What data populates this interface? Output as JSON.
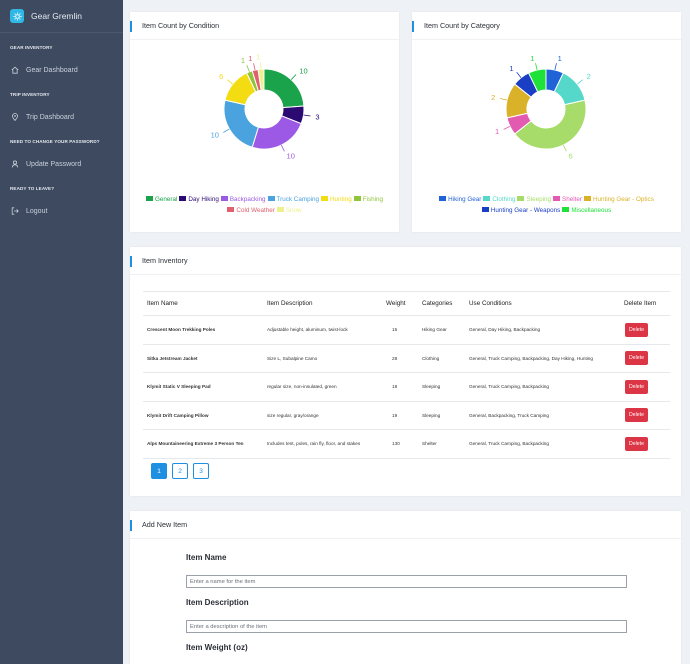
{
  "app": {
    "title": "Gear Gremlin",
    "brand_color": "#2fb7e6"
  },
  "sidebar": {
    "sections": [
      {
        "heading": "GEAR INVENTORY",
        "item": {
          "label": "Gear Dashboard",
          "icon": "home-icon"
        }
      },
      {
        "heading": "TRIP INVENTORY",
        "item": {
          "label": "Trip Dashboard",
          "icon": "map-pin-icon"
        }
      },
      {
        "heading": "NEED TO CHANGE YOUR PASSWORD?",
        "item": {
          "label": "Update Password",
          "icon": "user-icon"
        }
      },
      {
        "heading": "READY TO LEAVE?",
        "item": {
          "label": "Logout",
          "icon": "logout-icon"
        }
      }
    ]
  },
  "condition_chart": {
    "title": "Item Count by Condition",
    "chart_data": {
      "type": "pie",
      "categories": [
        "General",
        "Day Hiking",
        "Backpacking",
        "Truck Camping",
        "Hunting",
        "Fishing",
        "Cold Weather",
        "Snow"
      ],
      "values": [
        10,
        3,
        10,
        10,
        6,
        1,
        1,
        1
      ],
      "colors": [
        "#1aa34a",
        "#2b0a72",
        "#9b59e6",
        "#4aa3df",
        "#f3dc12",
        "#8fc43c",
        "#e0606d",
        "#eef08e"
      ]
    }
  },
  "category_chart": {
    "title": "Item Count by Category",
    "chart_data": {
      "type": "pie",
      "categories": [
        "Hiking Gear",
        "Clothing",
        "Sleeping",
        "Shelter",
        "Hunting Gear - Optics",
        "Hunting Gear - Weapons",
        "Miscellaneous"
      ],
      "values": [
        1,
        2,
        6,
        1,
        2,
        1,
        1
      ],
      "colors": [
        "#1f63d6",
        "#55d8c9",
        "#a8dc6a",
        "#e35bb0",
        "#d9b22a",
        "#1a3fc4",
        "#1ee23a"
      ]
    }
  },
  "inventory": {
    "title": "Item Inventory",
    "columns": [
      "Item Name",
      "Item Description",
      "Weight",
      "Categories",
      "Use Conditions",
      "Delete Item"
    ],
    "rows": [
      {
        "name": "Crescent Moon Trekking Poles",
        "description": "Adjustable height, aluminum, twist-lock",
        "weight": "16",
        "category": "Hiking Gear",
        "conditions": "General, Day Hiking, Backpacking",
        "action": "Delete"
      },
      {
        "name": "Sitka Jetstream Jacket",
        "description": "Size L, Subalpine Camo",
        "weight": "28",
        "category": "Clothing",
        "conditions": "General, Truck Camping, Backpacking, Day Hiking, Hunting",
        "action": "Delete"
      },
      {
        "name": "Klymit Static V Sleeping Pad",
        "description": "regular size, non-insulated, green",
        "weight": "18",
        "category": "Sleeping",
        "conditions": "General, Truck Camping, Backpacking",
        "action": "Delete"
      },
      {
        "name": "Klymit Drift Camping Pillow",
        "description": "size regular, gray/orange",
        "weight": "19",
        "category": "Sleeping",
        "conditions": "General, Backpacking, Truck Camping",
        "action": "Delete"
      },
      {
        "name": "Alps Mountaineering Extreme 3 Person Ten",
        "description": "Includes tent, poles, rain fly, floor, and stakes",
        "weight": "130",
        "category": "Shelter",
        "conditions": "General, Truck Camping, Backpacking",
        "action": "Delete"
      }
    ],
    "pages": [
      "1",
      "2",
      "3"
    ],
    "current_page": "1"
  },
  "add_item": {
    "title": "Add New Item",
    "name_label": "Item Name",
    "name_placeholder": "Enter a name for the item",
    "desc_label": "Item Description",
    "desc_placeholder": "Enter a description of the item",
    "weight_label": "Item Weight (oz)"
  }
}
